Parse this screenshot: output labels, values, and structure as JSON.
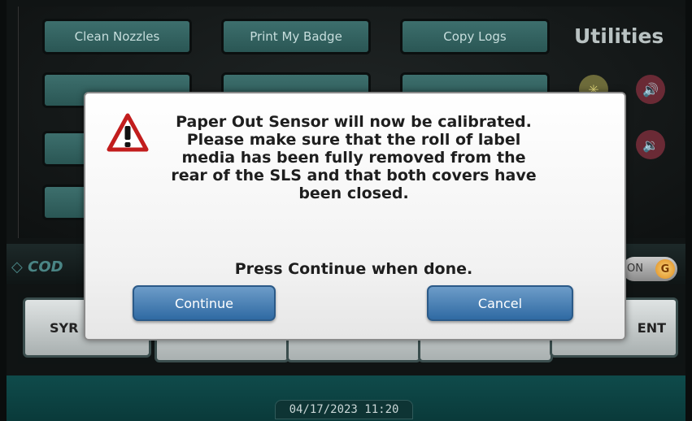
{
  "utilities": {
    "title": "Utilities",
    "buttons": [
      "Clean Nozzles",
      "Print My Badge",
      "Copy Logs"
    ]
  },
  "brand_partial": "COD",
  "power_pill": {
    "label": "ON",
    "icon": "power-g-icon"
  },
  "nav": {
    "left_label": "SYR",
    "right_label": "ENT"
  },
  "datetime": "04/17/2023 11:20",
  "dialog": {
    "icon": "warning-icon",
    "message": "Paper Out Sensor will now be calibrated. Please make sure that the roll of label media has been fully removed from the rear of the SLS and that both covers have been closed.",
    "prompt": "Press Continue when done.",
    "continue_label": "Continue",
    "cancel_label": "Cancel"
  },
  "colors": {
    "accent_teal": "#2f5f5d",
    "dialog_button": "#2f6aa3"
  }
}
